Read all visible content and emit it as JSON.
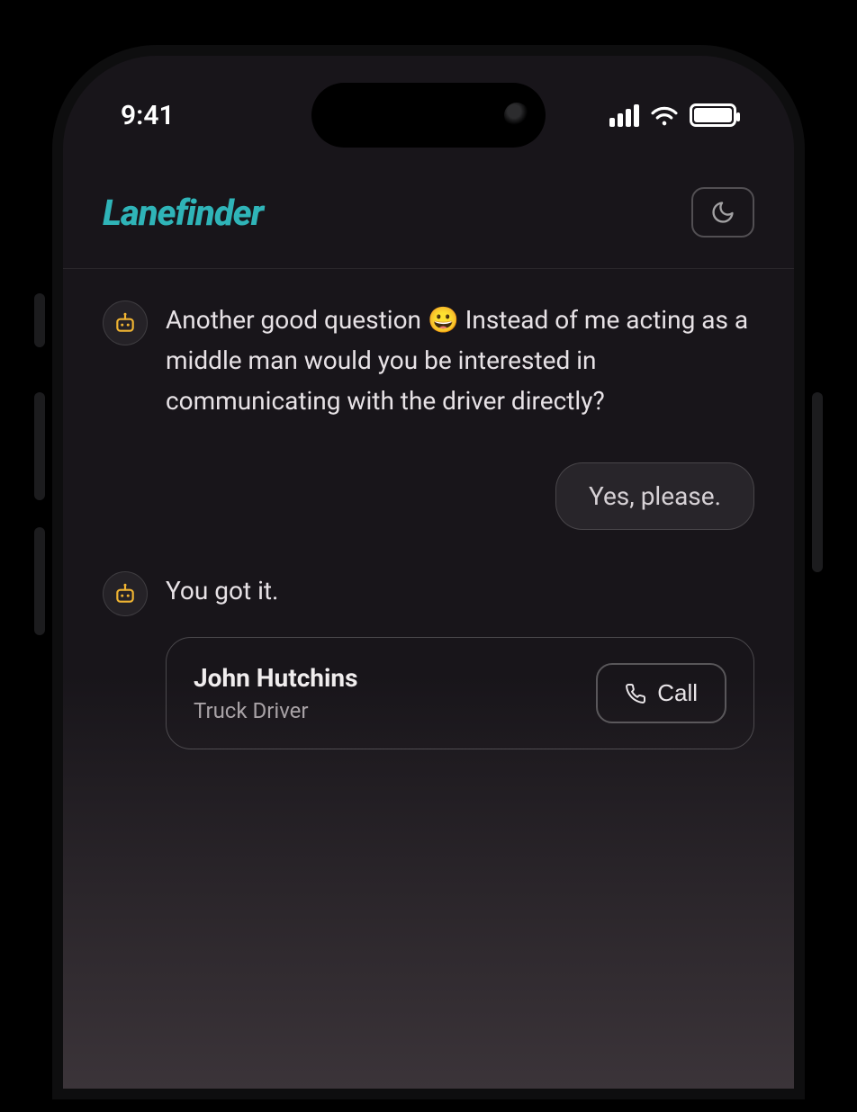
{
  "status": {
    "time": "9:41"
  },
  "header": {
    "logo": "Lanefinder"
  },
  "chat": {
    "bot1": "Another good question 😀 Instead of me acting as a middle man would you be interested in communicating with the driver directly?",
    "user1": "Yes, please.",
    "bot2": "You got it.",
    "contact": {
      "name": "John Hutchins",
      "role": "Truck Driver",
      "call_label": "Call"
    }
  }
}
